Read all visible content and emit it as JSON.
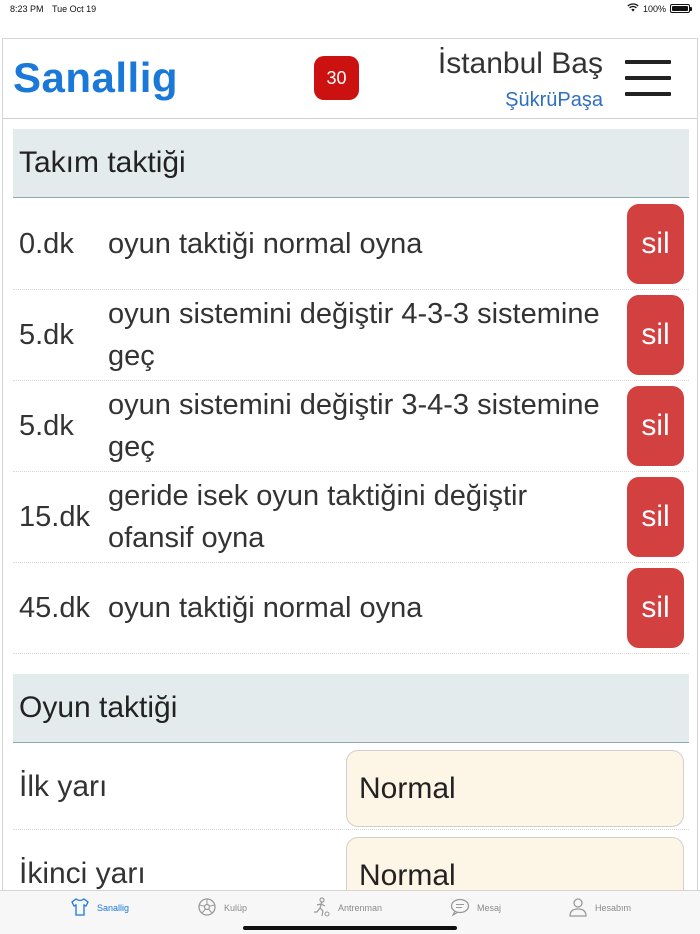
{
  "status_bar": {
    "time": "8:23 PM",
    "date": "Tue Oct 19",
    "battery_text": "100%",
    "battery_level": 1.0
  },
  "header": {
    "brand": "Sanallig",
    "badge": "30",
    "team_name": "İstanbul Baş",
    "coach_name": "ŞükrüPaşa"
  },
  "team_tactics": {
    "title": "Takım taktiği",
    "delete_label": "sil",
    "rows": [
      {
        "minute": "0.dk",
        "desc": "oyun taktiği normal oyna"
      },
      {
        "minute": "5.dk",
        "desc": "oyun sistemini değiştir 4-3-3 sistemine geç"
      },
      {
        "minute": "5.dk",
        "desc": "oyun sistemini değiştir 3-4-3 sistemine geç"
      },
      {
        "minute": "15.dk",
        "desc": "geride isek oyun taktiğini değiştir ofansif oyna"
      },
      {
        "minute": "45.dk",
        "desc": "oyun taktiği normal oyna"
      }
    ]
  },
  "game_tactics": {
    "title": "Oyun taktiği",
    "first_half": {
      "label": "İlk yarı",
      "value": "Normal"
    },
    "second_half": {
      "label": "İkinci yarı",
      "value": "Normal"
    }
  },
  "tabbar": {
    "tabs": [
      {
        "label": "Sanallig",
        "icon": "shirt-icon",
        "active": true
      },
      {
        "label": "Kulüp",
        "icon": "ball-icon",
        "active": false
      },
      {
        "label": "Antrenman",
        "icon": "player-icon",
        "active": false
      },
      {
        "label": "Mesaj",
        "icon": "chat-icon",
        "active": false
      },
      {
        "label": "Hesabım",
        "icon": "person-icon",
        "active": false
      }
    ]
  }
}
